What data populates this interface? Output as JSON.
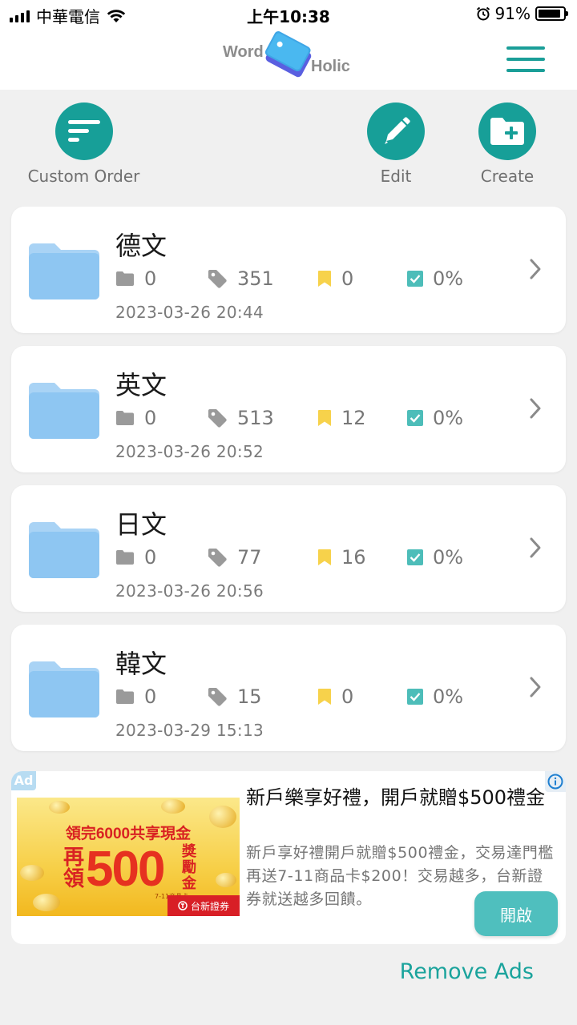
{
  "status": {
    "carrier": "中華電信",
    "time": "上午10:38",
    "battery": "91%",
    "battery_level": 0.91
  },
  "header": {
    "logo_word": "Word",
    "logo_holic": "Holic",
    "accent_color": "#179f98"
  },
  "actions": {
    "custom_order": "Custom Order",
    "edit": "Edit",
    "create": "Create"
  },
  "folders": [
    {
      "title": "德文",
      "subfolders": "0",
      "words": "351",
      "bookmarks": "0",
      "progress": "0%",
      "date": "2023-03-26 20:44",
      "bookmark_color": "#f7d24b"
    },
    {
      "title": "英文",
      "subfolders": "0",
      "words": "513",
      "bookmarks": "12",
      "progress": "0%",
      "date": "2023-03-26 20:52",
      "bookmark_color": "#f7d24b"
    },
    {
      "title": "日文",
      "subfolders": "0",
      "words": "77",
      "bookmarks": "16",
      "progress": "0%",
      "date": "2023-03-26 20:56",
      "bookmark_color": "#f7d24b"
    },
    {
      "title": "韓文",
      "subfolders": "0",
      "words": "15",
      "bookmarks": "0",
      "progress": "0%",
      "date": "2023-03-29 15:13",
      "bookmark_color": "#f7d24b"
    }
  ],
  "ad": {
    "badge": "Ad",
    "banner_line1": "領完6000共享現金",
    "banner_zai": "再領",
    "banner_500": "500",
    "banner_jiang": "獎勵金",
    "banner_small": "7-11商品卡",
    "banner_brand": "台新證券",
    "headline": "新戶樂享好禮，開戶就贈$500禮金",
    "body": "新戶享好禮開戶就贈$500禮金，交易達門檻再送7-11商品卡$200！交易越多，台新證券就送越多回饋。",
    "open_button": "開啟"
  },
  "remove_ads": "Remove Ads"
}
